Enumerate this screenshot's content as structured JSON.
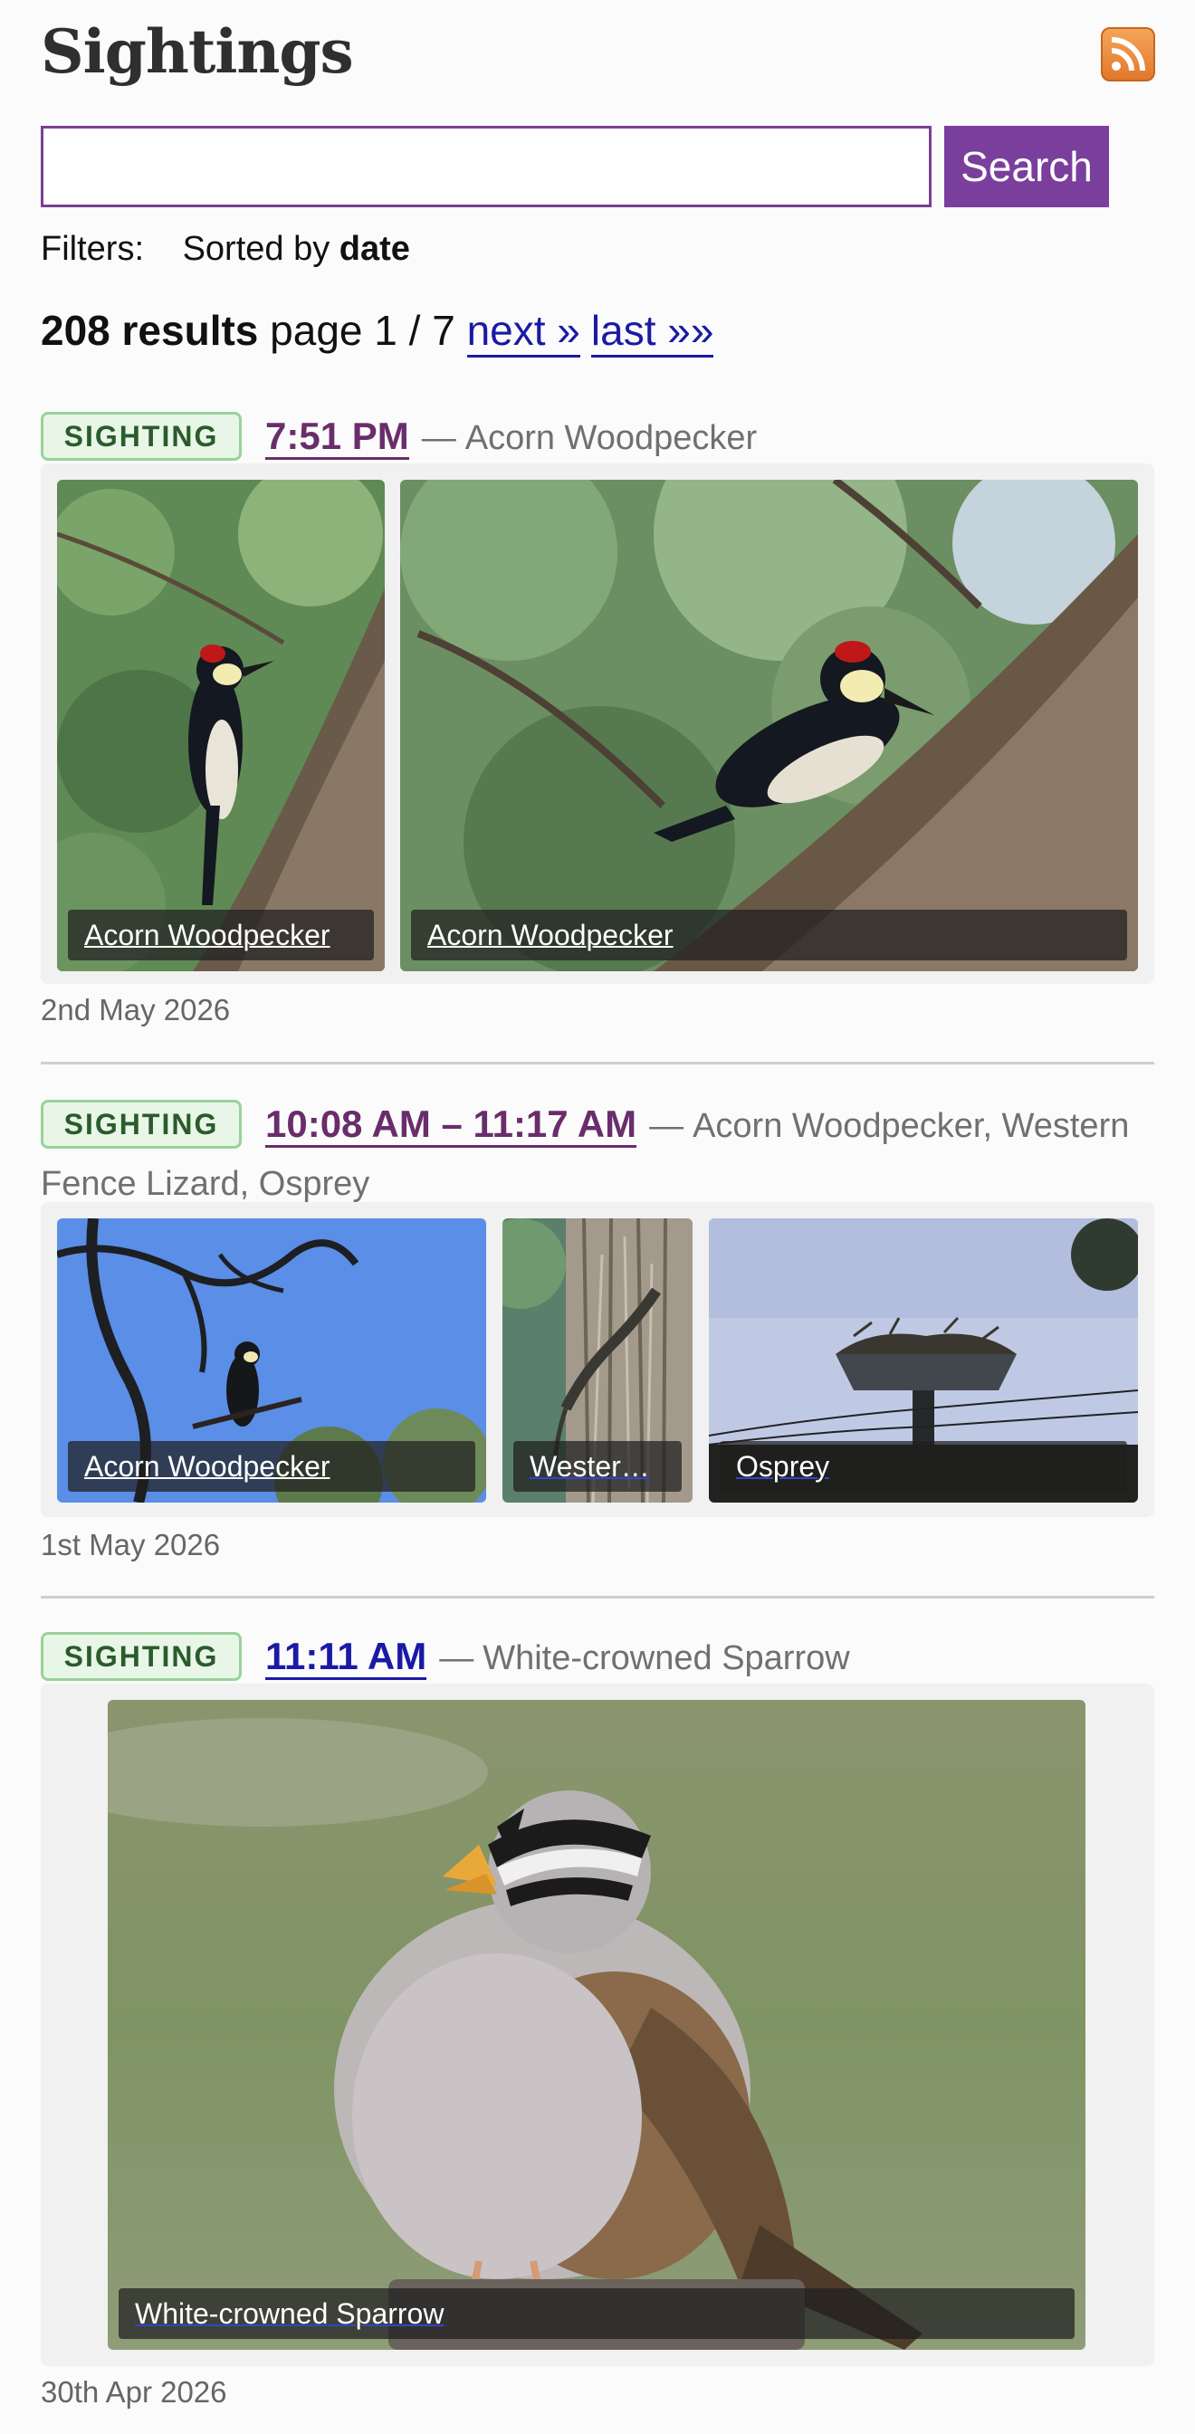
{
  "header": {
    "title": "Sightings",
    "feed_icon": "rss-icon"
  },
  "search": {
    "value": "",
    "placeholder": "",
    "button_label": "Search"
  },
  "filters": {
    "label": "Filters:",
    "sorted_prefix": "Sorted by",
    "sorted_value": "date"
  },
  "results": {
    "count": "208 results",
    "page_text": "page 1 / 7",
    "next_label": "next »",
    "last_label": "last »»"
  },
  "sightings": [
    {
      "badge": "SIGHTING",
      "time": "7:51 PM",
      "dash": "—",
      "species_text": "Acorn Woodpecker",
      "photos": [
        {
          "caption": "Acorn Woodpecker",
          "subject": "acorn-woodpecker"
        },
        {
          "caption": "Acorn Woodpecker",
          "subject": "acorn-woodpecker"
        }
      ],
      "date": "2nd May 2026"
    },
    {
      "badge": "SIGHTING",
      "time": "10:08 AM – 11:17 AM",
      "dash": "—",
      "species_text": "Acorn Woodpecker, Western Fence Lizard, Osprey",
      "photos": [
        {
          "caption": "Acorn Woodpecker",
          "subject": "acorn-woodpecker"
        },
        {
          "caption": "Wester…",
          "subject": "western-fence-lizard"
        },
        {
          "caption": "Osprey",
          "subject": "osprey"
        }
      ],
      "date": "1st May 2026"
    },
    {
      "badge": "SIGHTING",
      "time": "11:11 AM",
      "dash": "—",
      "species_text": "White-crowned Sparrow",
      "photos": [
        {
          "caption": "White-crowned Sparrow",
          "subject": "white-crowned-sparrow"
        }
      ],
      "date": "30th Apr 2026"
    }
  ],
  "colors": {
    "accent_purple": "#7a3f9c",
    "visited_link": "#6a2d6b",
    "link_blue": "#1a1aa6",
    "badge_green": "#2b5b2b"
  }
}
